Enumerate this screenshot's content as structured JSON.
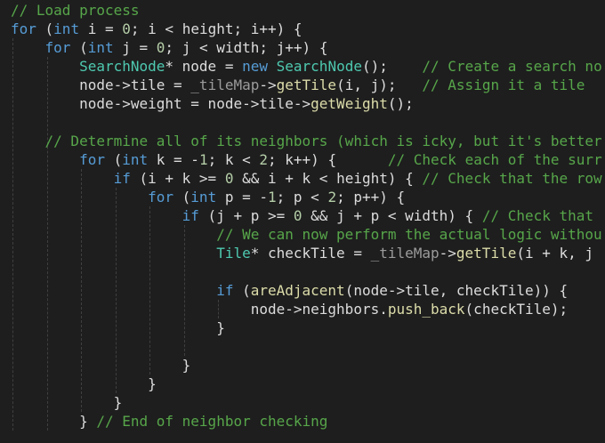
{
  "colors": {
    "background": "#1e1e1e",
    "default": "#dcdcdc",
    "keyword": "#569cd6",
    "comment": "#57a64a",
    "type": "#4ec9b0",
    "method": "#dcdcaa",
    "member": "#9b9b9b",
    "number": "#b5cea8",
    "guide": "#3f3f3f"
  },
  "code": [
    [
      [
        "c",
        "// Load process"
      ]
    ],
    [
      [
        "k",
        "for"
      ],
      [
        "p",
        " ("
      ],
      [
        "k",
        "int"
      ],
      [
        "p",
        " i = "
      ],
      [
        "n",
        "0"
      ],
      [
        "p",
        "; i < height; i++) {"
      ]
    ],
    [
      [
        "p",
        "    "
      ],
      [
        "k",
        "for"
      ],
      [
        "p",
        " ("
      ],
      [
        "k",
        "int"
      ],
      [
        "p",
        " j = "
      ],
      [
        "n",
        "0"
      ],
      [
        "p",
        "; j < width; j++) {"
      ]
    ],
    [
      [
        "p",
        "        "
      ],
      [
        "t",
        "SearchNode"
      ],
      [
        "p",
        "* node = "
      ],
      [
        "k",
        "new"
      ],
      [
        "p",
        " "
      ],
      [
        "t",
        "SearchNode"
      ],
      [
        "p",
        "();    "
      ],
      [
        "c",
        "// Create a search no"
      ]
    ],
    [
      [
        "p",
        "        node->tile = "
      ],
      [
        "v",
        "_tileMap"
      ],
      [
        "p",
        "->"
      ],
      [
        "m",
        "getTile"
      ],
      [
        "p",
        "(i, j);   "
      ],
      [
        "c",
        "// Assign it a tile"
      ]
    ],
    [
      [
        "p",
        "        node->weight = node->tile->"
      ],
      [
        "m",
        "getWeight"
      ],
      [
        "p",
        "();"
      ]
    ],
    [],
    [
      [
        "p",
        "    "
      ],
      [
        "c",
        "// Determine all of its neighbors (which is icky, but it's better"
      ]
    ],
    [
      [
        "p",
        "        "
      ],
      [
        "k",
        "for"
      ],
      [
        "p",
        " ("
      ],
      [
        "k",
        "int"
      ],
      [
        "p",
        " k = -"
      ],
      [
        "n",
        "1"
      ],
      [
        "p",
        "; k < "
      ],
      [
        "n",
        "2"
      ],
      [
        "p",
        "; k++) {      "
      ],
      [
        "c",
        "// Check each of the surr"
      ]
    ],
    [
      [
        "p",
        "            "
      ],
      [
        "k",
        "if"
      ],
      [
        "p",
        " (i + k >= "
      ],
      [
        "n",
        "0"
      ],
      [
        "p",
        " && i + k < height) { "
      ],
      [
        "c",
        "// Check that the row"
      ]
    ],
    [
      [
        "p",
        "                "
      ],
      [
        "k",
        "for"
      ],
      [
        "p",
        " ("
      ],
      [
        "k",
        "int"
      ],
      [
        "p",
        " p = -"
      ],
      [
        "n",
        "1"
      ],
      [
        "p",
        "; p < "
      ],
      [
        "n",
        "2"
      ],
      [
        "p",
        "; p++) {"
      ]
    ],
    [
      [
        "p",
        "                    "
      ],
      [
        "k",
        "if"
      ],
      [
        "p",
        " (j + p >= "
      ],
      [
        "n",
        "0"
      ],
      [
        "p",
        " && j + p < width) { "
      ],
      [
        "c",
        "// Check that"
      ]
    ],
    [
      [
        "p",
        "                        "
      ],
      [
        "c",
        "// We can now perform the actual logic withou"
      ]
    ],
    [
      [
        "p",
        "                        "
      ],
      [
        "t",
        "Tile"
      ],
      [
        "p",
        "* checkTile = "
      ],
      [
        "v",
        "_tileMap"
      ],
      [
        "p",
        "->"
      ],
      [
        "m",
        "getTile"
      ],
      [
        "p",
        "(i + k, j"
      ]
    ],
    [],
    [
      [
        "p",
        "                        "
      ],
      [
        "k",
        "if"
      ],
      [
        "p",
        " ("
      ],
      [
        "m",
        "areAdjacent"
      ],
      [
        "p",
        "(node->tile, checkTile)) {"
      ]
    ],
    [
      [
        "p",
        "                            node->neighbors."
      ],
      [
        "m",
        "push_back"
      ],
      [
        "p",
        "(checkTile);"
      ]
    ],
    [
      [
        "p",
        "                        }"
      ]
    ],
    [],
    [
      [
        "p",
        "                    }"
      ]
    ],
    [
      [
        "p",
        "                }"
      ]
    ],
    [
      [
        "p",
        "            }"
      ]
    ],
    [
      [
        "p",
        "        } "
      ],
      [
        "c",
        "// End of neighbor checking"
      ]
    ]
  ]
}
